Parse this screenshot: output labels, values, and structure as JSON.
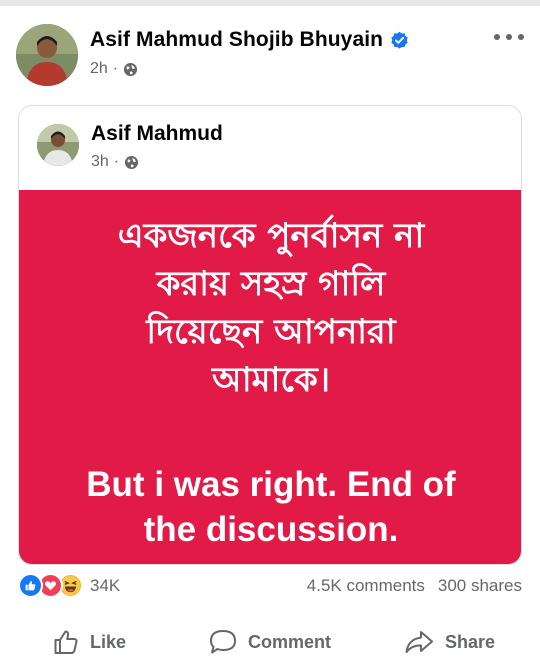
{
  "post": {
    "author": "Asif Mahmud Shojib Bhuyain",
    "time": "2h",
    "separator": "·",
    "audience_icon": "globe-icon",
    "verified_icon": "verified-badge-icon",
    "more_icon": "more-horizontal-icon"
  },
  "shared": {
    "author": "Asif Mahmud",
    "time": "3h",
    "separator": "·",
    "audience_icon": "globe-icon",
    "card_color": "#e11a47",
    "bangla_lines": [
      "একজনকে পুনর্বাসন না",
      "করায় সহস্র গালি",
      "দিয়েছেন আপনারা",
      "আমাকে।"
    ],
    "english_lines": [
      "But i was right. End of",
      "the discussion."
    ]
  },
  "stats": {
    "reaction_icons": [
      "like-reaction-icon",
      "love-reaction-icon",
      "haha-reaction-icon"
    ],
    "reaction_count": "34K",
    "comments": "4.5K comments",
    "shares": "300 shares"
  },
  "actions": {
    "like": "Like",
    "comment": "Comment",
    "share": "Share"
  },
  "colors": {
    "brand_blue": "#1877f2",
    "secondary_text": "#65676b"
  }
}
